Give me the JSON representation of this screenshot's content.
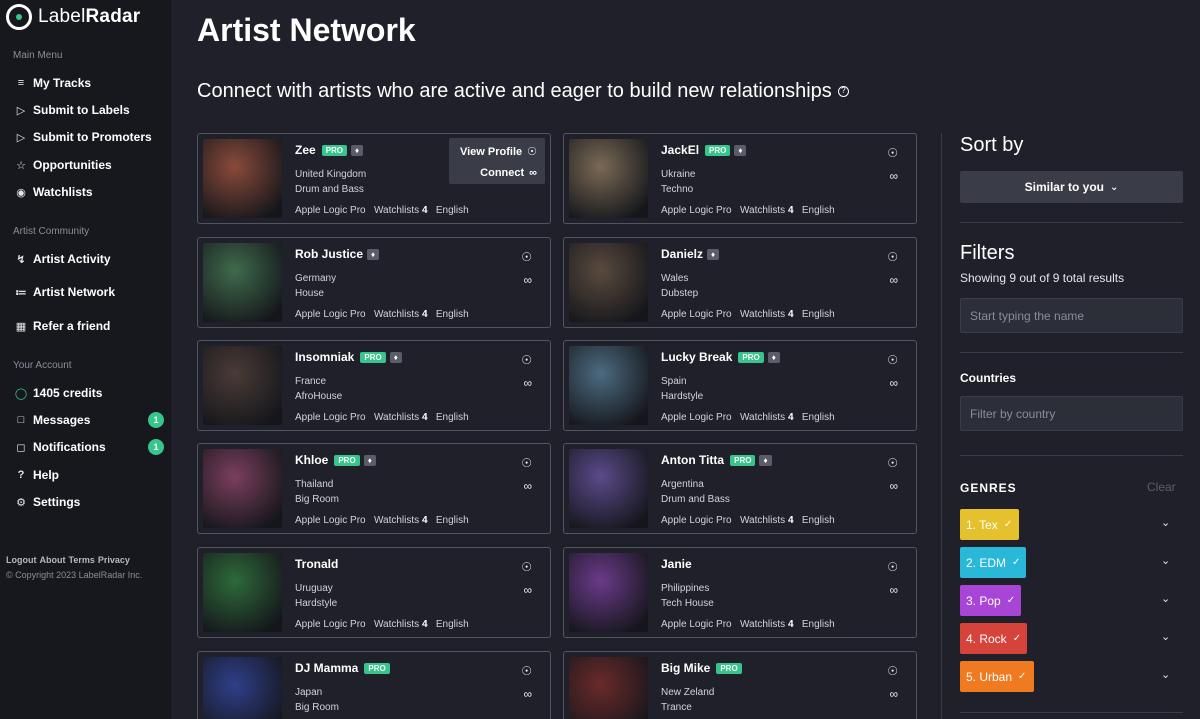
{
  "sidebar": {
    "logo": {
      "text_light": "Label",
      "text_bold": "Radar"
    },
    "sections": {
      "main_menu": "Main Menu",
      "artist_community": "Artist Community",
      "your_account": "Your Account"
    },
    "items": [
      {
        "label": "My Tracks",
        "icon": "tracks-icon"
      },
      {
        "label": "Submit to Labels",
        "icon": "send-icon"
      },
      {
        "label": "Submit to Promoters",
        "icon": "send-icon"
      },
      {
        "label": "Opportunities",
        "icon": "star-icon"
      },
      {
        "label": "Watchlists",
        "icon": "eye-icon"
      },
      {
        "label": "Artist Activity",
        "icon": "bolt-icon"
      },
      {
        "label": "Artist Network",
        "icon": "network-icon"
      },
      {
        "label": "Refer a friend",
        "icon": "gift-icon"
      },
      {
        "label": "1405 credits",
        "icon": "credits-icon"
      },
      {
        "label": "Messages",
        "icon": "messages-icon",
        "badge": "1"
      },
      {
        "label": "Notifications",
        "icon": "bell-icon",
        "badge": "1"
      },
      {
        "label": "Help",
        "icon": "help-icon"
      },
      {
        "label": "Settings",
        "icon": "settings-icon"
      }
    ],
    "footer_links": [
      "Logout",
      "About",
      "Terms",
      "Privacy"
    ],
    "copyright": "© Copyright 2023 LabelRadar Inc."
  },
  "main": {
    "title": "Artist Network",
    "subtitle": "Connect with artists who are active and eager to build new relationships",
    "hover_menu": {
      "view_profile": "View Profile",
      "connect": "Connect"
    },
    "artists": [
      {
        "name": "Zee",
        "pro": "PRO",
        "gem": true,
        "country": "United Kingdom",
        "genre": "Drum and Bass",
        "software": "Apple Logic Pro",
        "watchlists_label": "Watchlists",
        "watchlists": "4",
        "language": "English"
      },
      {
        "name": "JackEl",
        "pro": "PRO",
        "gem": true,
        "country": "Ukraine",
        "genre": "Techno",
        "software": "Apple Logic Pro",
        "watchlists_label": "Watchlists",
        "watchlists": "4",
        "language": "English"
      },
      {
        "name": "Rob Justice",
        "pro": "",
        "gem": true,
        "country": "Germany",
        "genre": "House",
        "software": "Apple Logic Pro",
        "watchlists_label": "Watchlists",
        "watchlists": "4",
        "language": "English"
      },
      {
        "name": "Danielz",
        "pro": "",
        "gem": true,
        "country": "Wales",
        "genre": "Dubstep",
        "software": "Apple Logic Pro",
        "watchlists_label": "Watchlists",
        "watchlists": "4",
        "language": "English"
      },
      {
        "name": "Insomniak",
        "pro": "PRO",
        "gem": true,
        "country": "France",
        "genre": "AfroHouse",
        "software": "Apple Logic Pro",
        "watchlists_label": "Watchlists",
        "watchlists": "4",
        "language": "English"
      },
      {
        "name": "Lucky Break",
        "pro": "PRO",
        "gem": true,
        "country": "Spain",
        "genre": "Hardstyle",
        "software": "Apple Logic Pro",
        "watchlists_label": "Watchlists",
        "watchlists": "4",
        "language": "English"
      },
      {
        "name": "Khloe",
        "pro": "PRO",
        "gem": true,
        "country": "Thailand",
        "genre": "Big Room",
        "software": "Apple Logic Pro",
        "watchlists_label": "Watchlists",
        "watchlists": "4",
        "language": "English"
      },
      {
        "name": "Anton Titta",
        "pro": "PRO",
        "gem": true,
        "country": "Argentina",
        "genre": "Drum and Bass",
        "software": "Apple Logic Pro",
        "watchlists_label": "Watchlists",
        "watchlists": "4",
        "language": "English"
      },
      {
        "name": "Tronald",
        "pro": "",
        "gem": false,
        "country": "Uruguay",
        "genre": "Hardstyle",
        "software": "Apple Logic Pro",
        "watchlists_label": "Watchlists",
        "watchlists": "4",
        "language": "English"
      },
      {
        "name": "Janie",
        "pro": "",
        "gem": false,
        "country": "Philippines",
        "genre": "Tech House",
        "software": "Apple Logic Pro",
        "watchlists_label": "Watchlists",
        "watchlists": "4",
        "language": "English"
      },
      {
        "name": "DJ Mamma",
        "pro": "PRO",
        "gem": false,
        "country": "Japan",
        "genre": "Big Room",
        "software": "",
        "watchlists_label": "",
        "watchlists": "",
        "language": ""
      },
      {
        "name": "Big Mike",
        "pro": "PRO",
        "gem": false,
        "country": "New Zeland",
        "genre": "Trance",
        "software": "",
        "watchlists_label": "",
        "watchlists": "",
        "language": ""
      }
    ]
  },
  "panel": {
    "sort_title": "Sort by",
    "sort_value": "Similar to you",
    "filters_title": "Filters",
    "filters_count": "Showing 9 out of 9 total results",
    "name_placeholder": "Start typing the name",
    "countries_label": "Countries",
    "country_placeholder": "Filter by country",
    "genres_title": "GENRES",
    "clear_label": "Clear",
    "genres": [
      {
        "label": "1. Tex",
        "color": "#e6c12e"
      },
      {
        "label": "2. EDM",
        "color": "#2ab8d9"
      },
      {
        "label": "3. Pop",
        "color": "#a945d6"
      },
      {
        "label": "4. Rock",
        "color": "#d6433a"
      },
      {
        "label": "5. Urban",
        "color": "#ef7a1f"
      }
    ]
  }
}
